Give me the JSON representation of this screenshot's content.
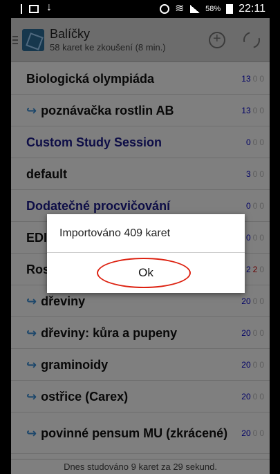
{
  "status_bar": {
    "battery_percent": "58%",
    "time": "22:11"
  },
  "action_bar": {
    "title": "Balíčky",
    "subtitle": "58 karet ke zkoušení (8 min.)"
  },
  "decks": [
    {
      "name": "Biologická olympiáda",
      "child": false,
      "dynamic": false,
      "new": "13",
      "lrn": "0",
      "rev": "0"
    },
    {
      "name": "poznávačka rostlin AB",
      "child": true,
      "dynamic": false,
      "new": "13",
      "lrn": "0",
      "rev": "0"
    },
    {
      "name": "Custom Study Session",
      "child": false,
      "dynamic": true,
      "new": "0",
      "lrn": "0",
      "rev": "0"
    },
    {
      "name": "default",
      "child": false,
      "dynamic": false,
      "new": "3",
      "lrn": "0",
      "rev": "0"
    },
    {
      "name": "Dodatečné procvičování",
      "child": false,
      "dynamic": true,
      "new": "0",
      "lrn": "0",
      "rev": "0"
    },
    {
      "name": "EDI",
      "child": false,
      "dynamic": false,
      "new": "0",
      "lrn": "0",
      "rev": "0"
    },
    {
      "name": "Ros",
      "child": false,
      "dynamic": false,
      "new": "2",
      "lrn": "2",
      "rev": "0"
    },
    {
      "name": "dřeviny",
      "child": true,
      "dynamic": false,
      "new": "20",
      "lrn": "0",
      "rev": "0"
    },
    {
      "name": "dřeviny: kůra a pupeny",
      "child": true,
      "dynamic": false,
      "new": "20",
      "lrn": "0",
      "rev": "0"
    },
    {
      "name": "graminoidy",
      "child": true,
      "dynamic": false,
      "new": "20",
      "lrn": "0",
      "rev": "0"
    },
    {
      "name": "ostřice (Carex)",
      "child": true,
      "dynamic": false,
      "new": "20",
      "lrn": "0",
      "rev": "0"
    },
    {
      "name": "povinné pensum MU (zkrácené)",
      "child": true,
      "dynamic": false,
      "new": "20",
      "lrn": "0",
      "rev": "0"
    }
  ],
  "footer": {
    "text": "Dnes studováno 9 karet za 29 sekund."
  },
  "dialog": {
    "message": "Importováno 409 karet",
    "ok_label": "Ok"
  },
  "colors": {
    "dynamic_deck": "#1a1a8c",
    "new_count": "#0000cc",
    "child_arrow": "#3a8fd6",
    "highlight_circle": "#d21"
  }
}
